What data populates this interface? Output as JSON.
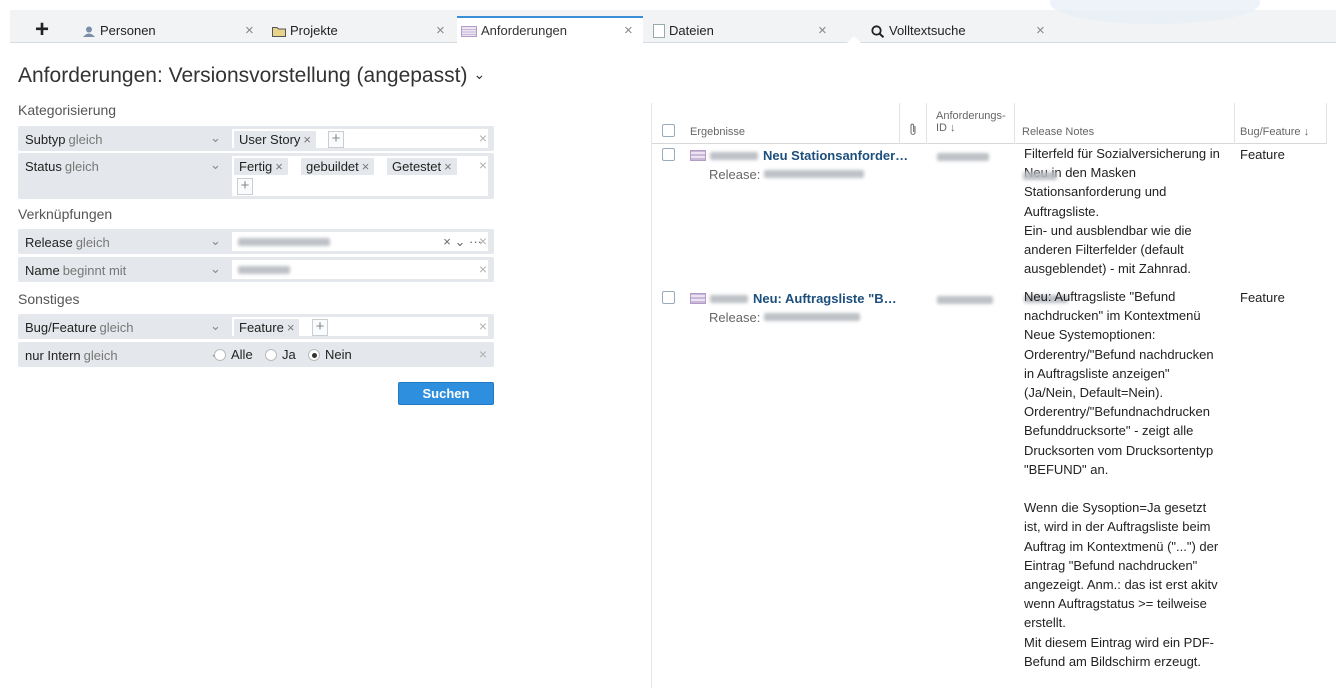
{
  "tabs": [
    {
      "label": "Personen",
      "icon": "person-icon"
    },
    {
      "label": "Projekte",
      "icon": "folder-icon"
    },
    {
      "label": "Anforderungen",
      "icon": "requirements-icon"
    },
    {
      "label": "Dateien",
      "icon": "file-icon"
    },
    {
      "label": "Volltextsuche",
      "icon": "search-icon"
    }
  ],
  "tab_close": "×",
  "new_tab": "+",
  "title": "Anforderungen: Versionsvorstellung (angepasst)",
  "title_caret": "⌄",
  "filters": {
    "sections": [
      "Kategorisierung",
      "Verknüpfungen",
      "Sonstiges"
    ],
    "subtyp": {
      "label": "Subtyp",
      "op": "gleich",
      "chips": [
        "User Story"
      ]
    },
    "status": {
      "label": "Status",
      "op": "gleich",
      "chips": [
        "Fertig",
        "gebuildet",
        "Getestet"
      ]
    },
    "release": {
      "label": "Release",
      "op": "gleich"
    },
    "name": {
      "label": "Name",
      "op": "beginnt mit"
    },
    "bugfeature": {
      "label": "Bug/Feature",
      "op": "gleich",
      "chips": [
        "Feature"
      ]
    },
    "intern": {
      "label": "nur Intern",
      "op": "gleich",
      "options": [
        "Alle",
        "Ja",
        "Nein"
      ],
      "selected": "Nein"
    },
    "chip_remove": "×",
    "add": "+",
    "chevron": "⌄",
    "clear": "×",
    "release_controls": "× ⌄ ···"
  },
  "search_button": "Suchen",
  "table": {
    "col_results": "Ergebnisse",
    "col_id_line1": "Anforderungs-",
    "col_id_line2": "ID ↓",
    "col_notes": "Release Notes",
    "col_bugfeature": "Bug/Feature ↓",
    "release_label": "Release:",
    "rows": [
      {
        "title": "Neu Stationsanforder…",
        "notes": "Filterfeld für Sozialversicherung in\n        Neu in den Masken\nStationsanforderung und\nAuftragsliste.\nEin- und ausblendbar wie die\nanderen Filterfelder (default\nausgeblendet) - mit Zahnrad.",
        "type": "Feature"
      },
      {
        "title": "Neu: Auftragsliste \"B…",
        "notes": "           Neu: Auftragsliste \"Befund\nnachdrucken\" im Kontextmenü\nNeue Systemoptionen:\nOrderentry/\"Befund nachdrucken\nin Auftragsliste anzeigen\"\n(Ja/Nein, Default=Nein).\nOrderentry/\"Befundnachdrucken\nBefunddrucksorte\" - zeigt alle\nDrucksorten vom Drucksortentyp\n\"BEFUND\" an.\n\nWenn die Sysoption=Ja gesetzt\nist, wird in der Auftragsliste beim\nAuftrag im Kontextmenü (\"...\") der\nEintrag \"Befund nachdrucken\"\nangezeigt. Anm.: das ist erst akitv\nwenn Auftragstatus >= teilweise\nerstellt.\nMit diesem Eintrag wird ein PDF-\nBefund am Bildschirm erzeugt.",
        "type": "Feature"
      }
    ]
  },
  "colors": {
    "accent": "#2f8fdf",
    "link": "#1d4f7d"
  }
}
